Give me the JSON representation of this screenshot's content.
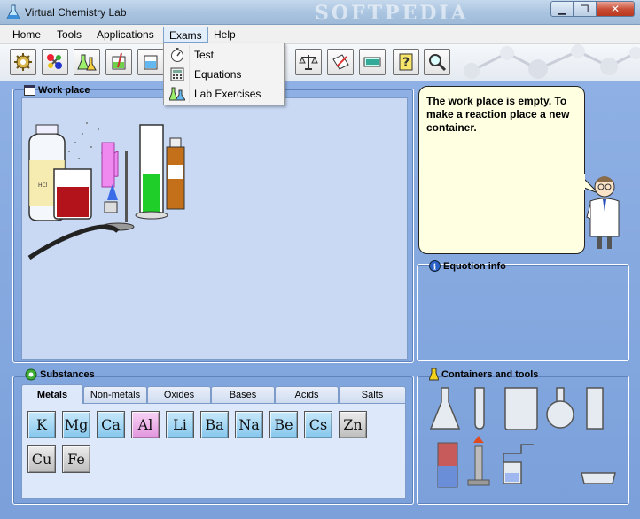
{
  "window": {
    "title": "Virtual Chemistry Lab",
    "watermark": "SOFTPEDIA"
  },
  "menu": {
    "items": [
      {
        "label": "Home",
        "active": false
      },
      {
        "label": "Tools",
        "active": false
      },
      {
        "label": "Applications",
        "active": false
      },
      {
        "label": "Exams",
        "active": true
      },
      {
        "label": "Help",
        "active": false
      }
    ],
    "exams_dropdown": [
      {
        "label": "Test",
        "icon": "stopwatch-icon"
      },
      {
        "label": "Equations",
        "icon": "calculator-icon"
      },
      {
        "label": "Lab Exercises",
        "icon": "flasks-icon"
      }
    ]
  },
  "toolbar": {
    "buttons": [
      {
        "icon": "gear-atom-icon"
      },
      {
        "icon": "molecule-icon"
      },
      {
        "icon": "flasks-icon"
      },
      {
        "icon": "beaker-stir-icon"
      },
      {
        "icon": "beaker-icon"
      },
      {
        "icon": "balance-scale-icon"
      },
      {
        "icon": "notebook-pen-icon"
      },
      {
        "icon": "display-icon"
      },
      {
        "icon": "help-icon"
      },
      {
        "icon": "magnifier-icon"
      }
    ]
  },
  "workplace": {
    "title": "Work place"
  },
  "assistant": {
    "message": "The work place is empty. To make a reaction place a new container."
  },
  "equation_info": {
    "title": "Equotion info"
  },
  "substances": {
    "title": "Substances",
    "tabs": [
      "Metals",
      "Non-metals",
      "Oxides",
      "Bases",
      "Acids",
      "Salts"
    ],
    "active_tab": "Metals",
    "elements": [
      {
        "symbol": "K",
        "group": "alkali"
      },
      {
        "symbol": "Mg",
        "group": "alkali"
      },
      {
        "symbol": "Ca",
        "group": "alkali"
      },
      {
        "symbol": "Al",
        "group": "post"
      },
      {
        "symbol": "Li",
        "group": "alkali"
      },
      {
        "symbol": "Ba",
        "group": "alkali"
      },
      {
        "symbol": "Na",
        "group": "alkali"
      },
      {
        "symbol": "Be",
        "group": "alkali"
      },
      {
        "symbol": "Cs",
        "group": "alkali"
      },
      {
        "symbol": "Zn",
        "group": "trans"
      },
      {
        "symbol": "Cu",
        "group": "trans"
      },
      {
        "symbol": "Fe",
        "group": "trans"
      }
    ]
  },
  "containers": {
    "title": "Containers and tools",
    "items": [
      {
        "icon": "erlenmeyer-flask-icon"
      },
      {
        "icon": "test-tube-icon"
      },
      {
        "icon": "beaker-icon"
      },
      {
        "icon": "round-flask-icon"
      },
      {
        "icon": "cylinder-icon"
      },
      {
        "icon": "solid-block-icon"
      },
      {
        "icon": "burner-icon"
      },
      {
        "icon": "gas-collector-icon"
      },
      {
        "icon": "evaporating-dish-icon"
      }
    ]
  },
  "colors": {
    "panel_bg": "#7ba0da",
    "bubble_bg": "#ffffe1",
    "work_bg": "#c9d9f4"
  }
}
